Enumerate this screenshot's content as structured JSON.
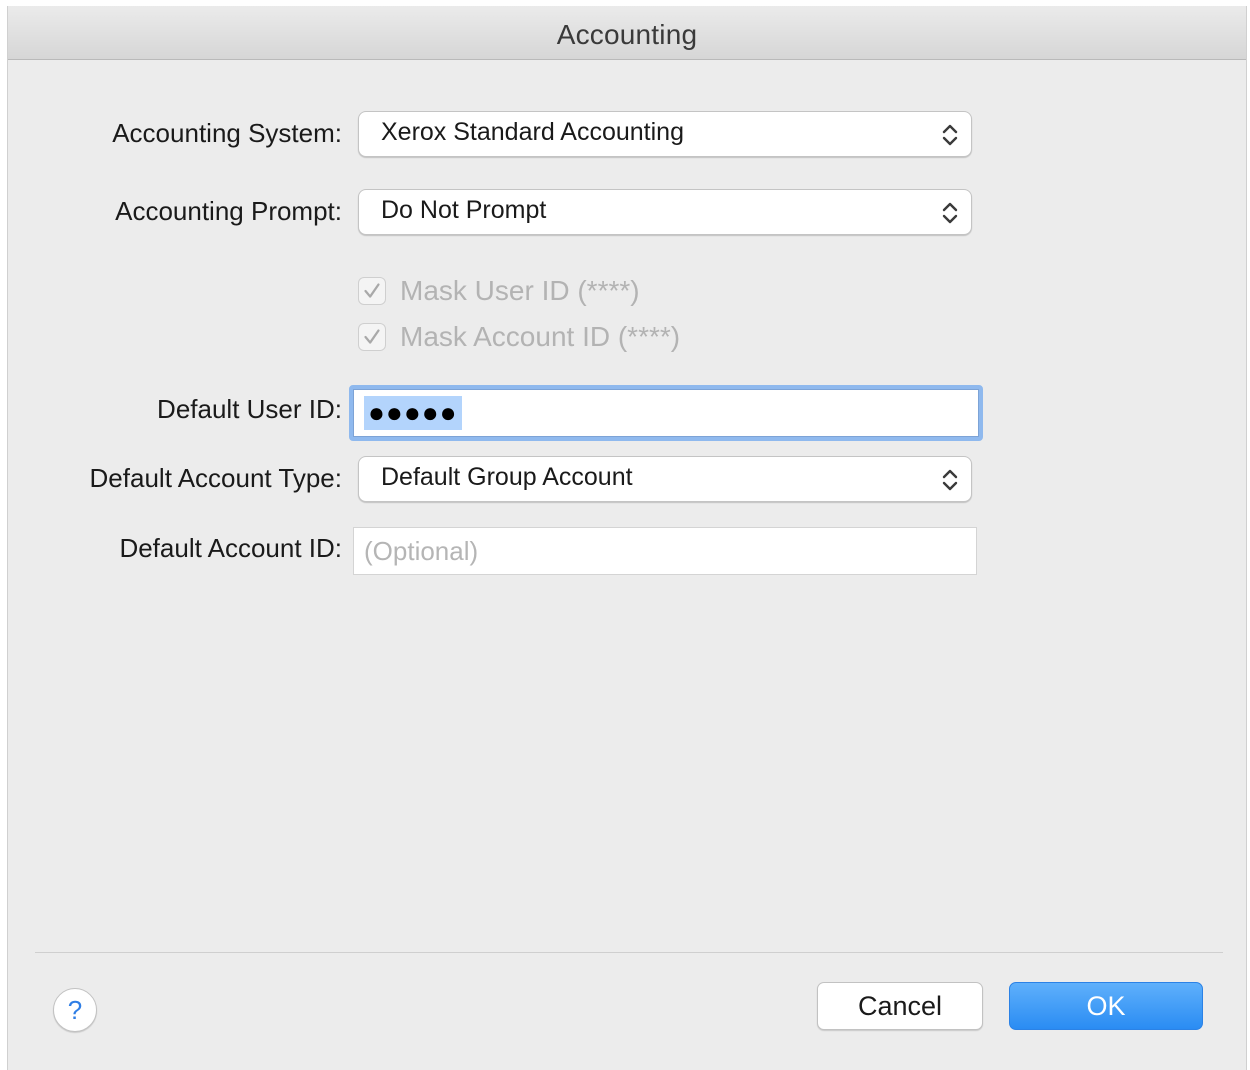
{
  "window": {
    "title": "Accounting"
  },
  "form": {
    "accounting_system": {
      "label": "Accounting System:",
      "value": "Xerox Standard Accounting"
    },
    "accounting_prompt": {
      "label": "Accounting Prompt:",
      "value": "Do Not Prompt"
    },
    "mask_user_id": {
      "label": "Mask User ID (****)",
      "checked": true,
      "enabled": false
    },
    "mask_account_id": {
      "label": "Mask Account ID (****)",
      "checked": true,
      "enabled": false
    },
    "default_user_id": {
      "label": "Default User ID:",
      "masked_value": "●●●●●"
    },
    "default_account_type": {
      "label": "Default Account Type:",
      "value": "Default Group Account"
    },
    "default_account_id": {
      "label": "Default Account ID:",
      "placeholder": "(Optional)",
      "value": ""
    }
  },
  "footer": {
    "help_label": "?",
    "cancel_label": "Cancel",
    "ok_label": "OK"
  },
  "colors": {
    "accent": "#2a8cf3",
    "focus_ring": "#8fb9ee",
    "selection": "#b3d4fc",
    "disabled_text": "#b3b3b3",
    "window_bg": "#ececec"
  },
  "icons": {
    "popup_arrows": "chevron-up-down-icon",
    "checkbox_check": "checkmark-icon",
    "help": "question-mark-icon"
  }
}
